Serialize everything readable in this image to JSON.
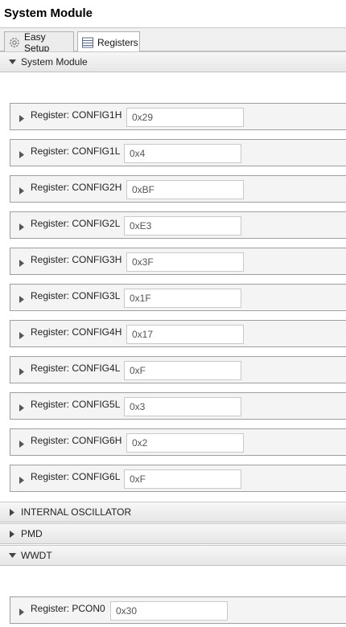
{
  "window": {
    "title": "System Module"
  },
  "tabs": [
    {
      "label": "Easy Setup",
      "icon": "gear-icon",
      "active": false
    },
    {
      "label": "Registers",
      "icon": "registers-icon",
      "active": true
    }
  ],
  "sections": {
    "system_module": {
      "label": "System Module",
      "expanded": true
    },
    "internal_oscillator": {
      "label": "INTERNAL OSCILLATOR",
      "expanded": false
    },
    "pmd": {
      "label": "PMD",
      "expanded": false
    },
    "wwdt": {
      "label": "WWDT",
      "expanded": true
    }
  },
  "system_registers": [
    {
      "label": "Register: CONFIG1H",
      "value": "0x29"
    },
    {
      "label": "Register: CONFIG1L",
      "value": "0x4"
    },
    {
      "label": "Register: CONFIG2H",
      "value": "0xBF"
    },
    {
      "label": "Register: CONFIG2L",
      "value": "0xE3"
    },
    {
      "label": "Register: CONFIG3H",
      "value": "0x3F"
    },
    {
      "label": "Register: CONFIG3L",
      "value": "0x1F"
    },
    {
      "label": "Register: CONFIG4H",
      "value": "0x17"
    },
    {
      "label": "Register: CONFIG4L",
      "value": "0xF"
    },
    {
      "label": "Register: CONFIG5L",
      "value": "0x3"
    },
    {
      "label": "Register: CONFIG6H",
      "value": "0x2"
    },
    {
      "label": "Register: CONFIG6L",
      "value": "0xF"
    }
  ],
  "wwdt_registers": [
    {
      "label": "Register: PCON0",
      "value": "0x30"
    }
  ],
  "colors": {
    "header_gradient_top": "#f7f7f7",
    "header_gradient_bottom": "#e6e6e6",
    "row_background": "#f4f4f4",
    "border": "#9e9e9e"
  }
}
